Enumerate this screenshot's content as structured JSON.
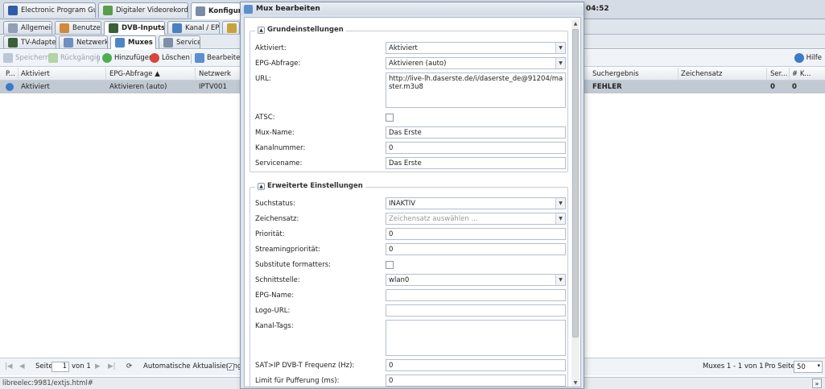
{
  "app_tabs": {
    "epg": "Electronic Program Guide",
    "dvr": "Digitaler Videorekorder",
    "config": "Konfiguration"
  },
  "clock": "04:52",
  "sub_tabs": {
    "general": "Allgemein",
    "users": "Benutzer",
    "dvb_inputs": "DVB-Inputs",
    "channel_epg": "Kanal / EPG"
  },
  "sub_tabs2": {
    "tv_adapter": "TV-Adapter",
    "networks": "Netzwerke",
    "muxes": "Muxes",
    "services": "Services"
  },
  "toolbar": {
    "save": "Speichern",
    "undo": "Rückgängig",
    "add": "Hinzufügen",
    "delete": "Löschen",
    "edit": "Bearbeiten",
    "help": "Hilfe"
  },
  "grid": {
    "columns": {
      "play": "P...",
      "enabled": "Aktiviert",
      "epg_scan": "EPG-Abfrage ▲",
      "network": "Netzwerk",
      "scan_result": "Suchergebnis",
      "charset": "Zeichensatz",
      "services": "Ser...",
      "channels": "# K..."
    },
    "rows": [
      {
        "enabled": "Aktiviert",
        "epg_scan": "Aktivieren (auto)",
        "network": "IPTV001",
        "scan_result": "FEHLER",
        "charset": "",
        "services": "0",
        "channels": "0"
      }
    ]
  },
  "pager": {
    "page_label": "Seite",
    "page_value": "1",
    "of_label": "von 1",
    "auto_refresh": "Automatische Aktualisierung",
    "auto_refresh_checked": "✓",
    "summary": "Muxes 1 - 1 von 1",
    "per_page_label": "Pro Seite",
    "per_page": "50"
  },
  "status_url": "libreelec:9981/extjs.html#",
  "modal": {
    "title": "Mux bearbeiten",
    "basic": {
      "legend": "Grundeinstellungen",
      "enabled_label": "Aktiviert:",
      "enabled_value": "Aktiviert",
      "epg_label": "EPG-Abfrage:",
      "epg_value": "Aktivieren (auto)",
      "url_label": "URL:",
      "url_value": "http://live-lh.daserste.de/i/daserste_de@91204/master.m3u8",
      "atsc_label": "ATSC:",
      "mux_name_label": "Mux-Name:",
      "mux_name_value": "Das Erste",
      "channel_number_label": "Kanalnummer:",
      "channel_number_value": "0",
      "service_name_label": "Servicename:",
      "service_name_value": "Das Erste"
    },
    "advanced": {
      "legend": "Erweiterte Einstellungen",
      "scan_status_label": "Suchstatus:",
      "scan_status_value": "INAKTIV",
      "charset_label": "Zeichensatz:",
      "charset_placeholder": "Zeichensatz auswählen ...",
      "priority_label": "Priorität:",
      "priority_value": "0",
      "streaming_priority_label": "Streamingpriorität:",
      "streaming_priority_value": "0",
      "substitute_label": "Substitute formatters:",
      "interface_label": "Schnittstelle:",
      "interface_value": "wlan0",
      "epg_name_label": "EPG-Name:",
      "epg_name_value": "",
      "logo_url_label": "Logo-URL:",
      "logo_url_value": "",
      "tags_label": "Kanal-Tags:",
      "tags_value": "",
      "satip_label": "SAT>IP DVB-T Frequenz (Hz):",
      "satip_value": "0",
      "buffer_label": "Limit für Pufferung (ms):",
      "buffer_value": "0"
    }
  }
}
